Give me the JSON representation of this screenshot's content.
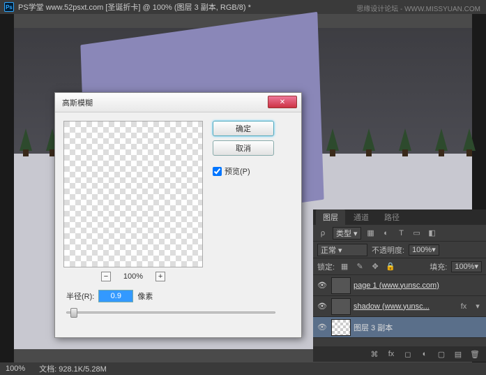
{
  "titlebar": {
    "app_prefix": "PS学堂  www.52psxt.com [圣诞折卡] @ 100% (图层 3 副本, RGB/8) *"
  },
  "watermark": "思缘设计论坛 - WWW.MISSYUAN.COM",
  "dialog": {
    "title": "高斯模糊",
    "ok": "确定",
    "cancel": "取消",
    "preview_label": "预览(P)",
    "zoom": "100%",
    "radius_label": "半径(R):",
    "radius_value": "0.9",
    "radius_unit": "像素"
  },
  "panels": {
    "tabs": {
      "layers": "图层",
      "channels": "通道",
      "paths": "路径"
    },
    "kind_label": "类型",
    "blend_mode": "正常",
    "opacity_label": "不透明度:",
    "opacity_value": "100%",
    "lock_label": "锁定:",
    "fill_label": "填充:",
    "fill_value": "100%",
    "layers_list": [
      {
        "name": "page 1 (www.yunsc.com)",
        "selected": false,
        "checker": false
      },
      {
        "name": "shadow (www.yunsc...",
        "selected": false,
        "checker": false,
        "fx": true
      },
      {
        "name": "图层 3 副本",
        "selected": true,
        "checker": true
      }
    ]
  },
  "statusbar": {
    "zoom": "100%",
    "doc_label": "文档:",
    "doc_size": "928.1K/5.28M"
  }
}
